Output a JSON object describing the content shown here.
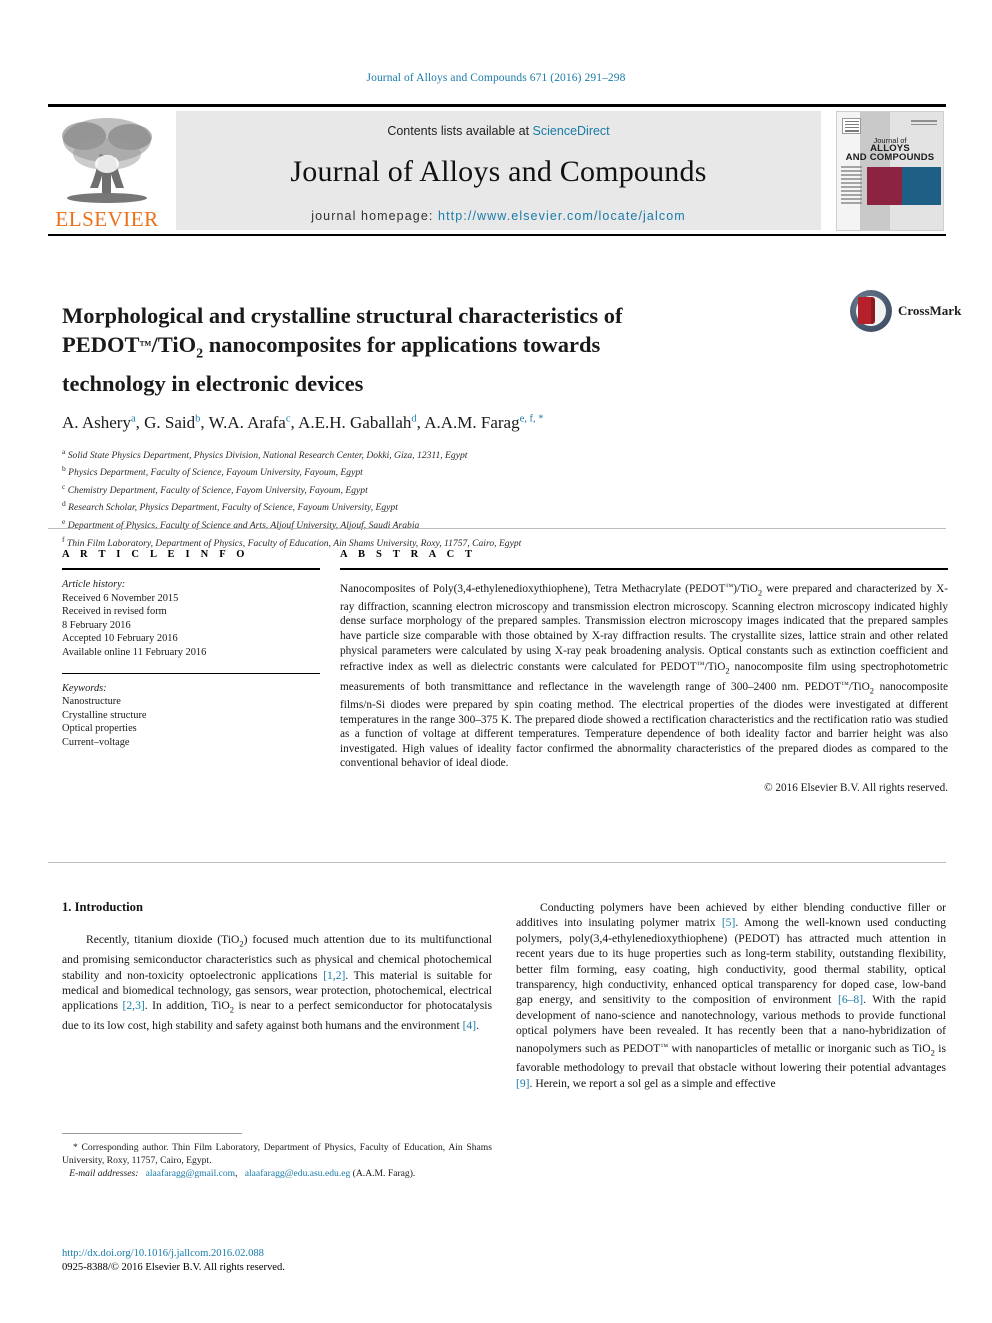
{
  "running_head": "Journal of Alloys and Compounds 671 (2016) 291–298",
  "masthead": {
    "contents_prefix": "Contents lists available at ",
    "contents_link": "ScienceDirect",
    "journal_title": "Journal of Alloys and Compounds",
    "homepage_prefix": "journal homepage: ",
    "homepage_url": "http://www.elsevier.com/locate/jalcom",
    "publisher_wordmark": "ELSEVIER",
    "cover_title_small": "Journal of",
    "cover_title_line1": "ALLOYS",
    "cover_title_line2": "AND COMPOUNDS"
  },
  "crossmark": {
    "label": "CrossMark"
  },
  "article": {
    "title_line1": "Morphological and crystalline structural characteristics of",
    "title_line2_a": "PEDOT",
    "title_line2_tm": "™",
    "title_line2_b": "/TiO",
    "title_line2_sub": "2",
    "title_line2_c": " nanocomposites for applications towards",
    "title_line3": "technology in electronic devices",
    "authors": [
      {
        "name": "A. Ashery",
        "sup": "a"
      },
      {
        "name": "G. Said",
        "sup": "b"
      },
      {
        "name": "W.A. Arafa",
        "sup": "c"
      },
      {
        "name": "A.E.H. Gaballah",
        "sup": "d"
      },
      {
        "name": "A.A.M. Farag",
        "sup": "e, f, *"
      }
    ],
    "affiliations": [
      {
        "marker": "a",
        "text": "Solid State Physics Department, Physics Division, National Research Center, Dokki, Giza, 12311, Egypt"
      },
      {
        "marker": "b",
        "text": "Physics Department, Faculty of Science, Fayoum University, Fayoum, Egypt"
      },
      {
        "marker": "c",
        "text": "Chemistry Department, Faculty of Science, Fayom University, Fayoum, Egypt"
      },
      {
        "marker": "d",
        "text": "Research Scholar, Physics Department, Faculty of Science, Fayoum University, Egypt"
      },
      {
        "marker": "e",
        "text": "Department of Physics, Faculty of Science and Arts, Aljouf University, Aljouf, Saudi Arabia"
      },
      {
        "marker": "f",
        "text": "Thin Film Laboratory, Department of Physics, Faculty of Education, Ain Shams University, Roxy, 11757, Cairo, Egypt"
      }
    ]
  },
  "article_info": {
    "heading": "A R T I C L E   I N F O",
    "history_label": "Article history:",
    "history": [
      "Received 6 November 2015",
      "Received in revised form",
      "8 February 2016",
      "Accepted 10 February 2016",
      "Available online 11 February 2016"
    ],
    "keywords_label": "Keywords:",
    "keywords": [
      "Nanostructure",
      "Crystalline structure",
      "Optical properties",
      "Current–voltage"
    ]
  },
  "abstract": {
    "heading": "A B S T R A C T",
    "part1": "Nanocomposites of Poly(3,4-ethylenedioxythiophene), Tetra Methacrylate (PEDOT",
    "part2": ")/TiO",
    "part3": " were prepared and characterized by X-ray diffraction, scanning electron microscopy and transmission electron microscopy. Scanning electron microscopy indicated highly dense surface morphology of the prepared samples. Transmission electron microscopy images indicated that the prepared samples have particle size comparable with those obtained by X-ray diffraction results. The crystallite sizes, lattice strain and other related physical parameters were calculated by using X-ray peak broadening analysis. Optical constants such as extinction coefficient and refractive index as well as dielectric constants were calculated for PEDOT",
    "part4": "/TiO",
    "part5": " nanocomposite film using spectrophotometric measurements of both transmittance and reflectance in the wavelength range of 300–2400 nm. PEDOT",
    "part6": "/TiO",
    "part7": " nanocomposite films/n-Si diodes were prepared by spin coating method. The electrical properties of the diodes were investigated at different temperatures in the range 300–375 K. The prepared diode showed a rectification characteristics and the rectification ratio was studied as a function of voltage at different temperatures. Temperature dependence of both ideality factor and barrier height was also investigated. High values of ideality factor confirmed the abnormality characteristics of the prepared diodes as compared to the conventional behavior of ideal diode.",
    "copyright": "© 2016 Elsevier B.V. All rights reserved."
  },
  "introduction": {
    "section_title": "1.  Introduction",
    "left_p1_a": "Recently, titanium dioxide (TiO",
    "left_p1_sub": "2",
    "left_p1_b": ") focused much attention due to its multifunctional and promising semiconductor characteristics such as physical and chemical photochemical stability and non-toxicity optoelectronic applications ",
    "left_ref1": "[1,2]",
    "left_p1_c": ". This material is suitable for medical and biomedical technology, gas sensors, wear protection, photochemical, electrical applications ",
    "left_ref2": "[2,3]",
    "left_p1_d": ". In addition, TiO",
    "left_p1_sub2": "2",
    "left_p1_e": " is near to a perfect semiconductor for photocatalysis due to its low cost, high stability and safety against both humans and the environment ",
    "left_ref3": "[4]",
    "left_p1_f": ".",
    "right_p1_a": "Conducting polymers have been achieved by either blending conductive filler or additives into insulating polymer matrix ",
    "right_ref1": "[5]",
    "right_p1_b": ". Among the well-known used conducting polymers, poly(3,4-ethylenedioxythiophene) (PEDOT) has attracted much attention in recent years due to its huge properties such as long-term stability, outstanding flexibility, better film forming, easy coating, high conductivity, good thermal stability, optical transparency, high conductivity, enhanced optical transparency for doped case, low-band gap energy, and sensitivity to the composition of environment ",
    "right_ref2": "[6–8]",
    "right_p1_c": ". With the rapid development of nano-science and nanotechnology, various methods to provide functional optical polymers have been revealed. It has recently been that a nano-hybridization of nanopolymers such as PEDOT",
    "right_p1_d": " with nanoparticles of metallic or inorganic such as TiO",
    "right_p1_sub": "2",
    "right_p1_e": " is favorable methodology to prevail that obstacle without lowering their potential advantages ",
    "right_ref3": "[9]",
    "right_p1_f": ". Herein, we report a sol gel as a simple and effective"
  },
  "footnotes": {
    "corresponding_star": "*",
    "corresponding_text": " Corresponding author. Thin Film Laboratory, Department of Physics, Faculty of Education, Ain Shams University, Roxy, 11757, Cairo, Egypt.",
    "email_label": "E-mail addresses:",
    "email1": "alaafaragg@gmail.com",
    "email_sep": ", ",
    "email2": "alaafaragg@edu.asu.edu.eg",
    "email_attrib": " (A.A.M. Farag)."
  },
  "doi_block": {
    "doi": "http://dx.doi.org/10.1016/j.jallcom.2016.02.088",
    "issn_line": "0925-8388/© 2016 Elsevier B.V. All rights reserved."
  }
}
